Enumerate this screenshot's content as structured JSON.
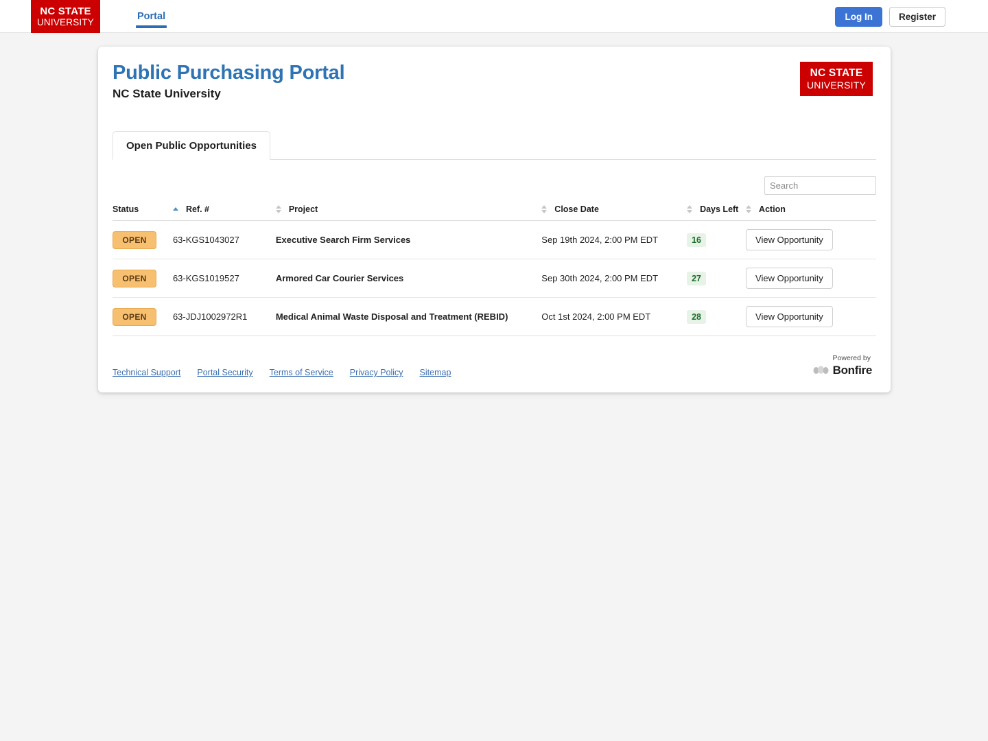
{
  "navbar": {
    "logo": {
      "line1": "NC STATE",
      "line2": "UNIVERSITY"
    },
    "links": [
      {
        "label": "Portal",
        "active": true
      }
    ],
    "login_label": "Log In",
    "register_label": "Register"
  },
  "card": {
    "title": "Public Purchasing Portal",
    "subtitle": "NC State University",
    "logo": {
      "line1": "NC STATE",
      "line2": "UNIVERSITY"
    }
  },
  "tabs": [
    {
      "label": "Open Public Opportunities",
      "active": true
    }
  ],
  "search": {
    "value": "",
    "placeholder": "Search"
  },
  "table": {
    "columns": [
      {
        "label": "Status",
        "sort": "asc"
      },
      {
        "label": "Ref. #",
        "sort": "none"
      },
      {
        "label": "Project",
        "sort": "none"
      },
      {
        "label": "Close Date",
        "sort": "none"
      },
      {
        "label": "Days Left",
        "sort": "none"
      },
      {
        "label": "Action",
        "sort": "none"
      }
    ],
    "rows": [
      {
        "status": "OPEN",
        "ref": "63-KGS1043027",
        "project": "Executive Search Firm Services",
        "close_date": "Sep 19th 2024, 2:00 PM EDT",
        "days_left": "16",
        "action": "View Opportunity"
      },
      {
        "status": "OPEN",
        "ref": "63-KGS1019527",
        "project": "Armored Car Courier Services",
        "close_date": "Sep 30th 2024, 2:00 PM EDT",
        "days_left": "27",
        "action": "View Opportunity"
      },
      {
        "status": "OPEN",
        "ref": "63-JDJ1002972R1",
        "project": "Medical Animal Waste Disposal and Treatment (REBID)",
        "close_date": "Oct 1st 2024, 2:00 PM EDT",
        "days_left": "28",
        "action": "View Opportunity"
      }
    ]
  },
  "footer": {
    "links": [
      {
        "label": "Technical Support"
      },
      {
        "label": "Portal Security"
      },
      {
        "label": "Terms of Service"
      },
      {
        "label": "Privacy Policy"
      },
      {
        "label": "Sitemap"
      }
    ],
    "powered_by": "Powered by",
    "brand": "Bonfire"
  },
  "colors": {
    "brand_red": "#cc0000",
    "title_blue": "#2e74b5",
    "link_blue": "#3b6fb0",
    "primary_button": "#3b74d4",
    "badge_open_bg": "#f7bf70",
    "badge_days_bg": "#e6f3e6",
    "badge_days_text": "#1d6b2a",
    "page_bg": "#f4f4f4"
  }
}
